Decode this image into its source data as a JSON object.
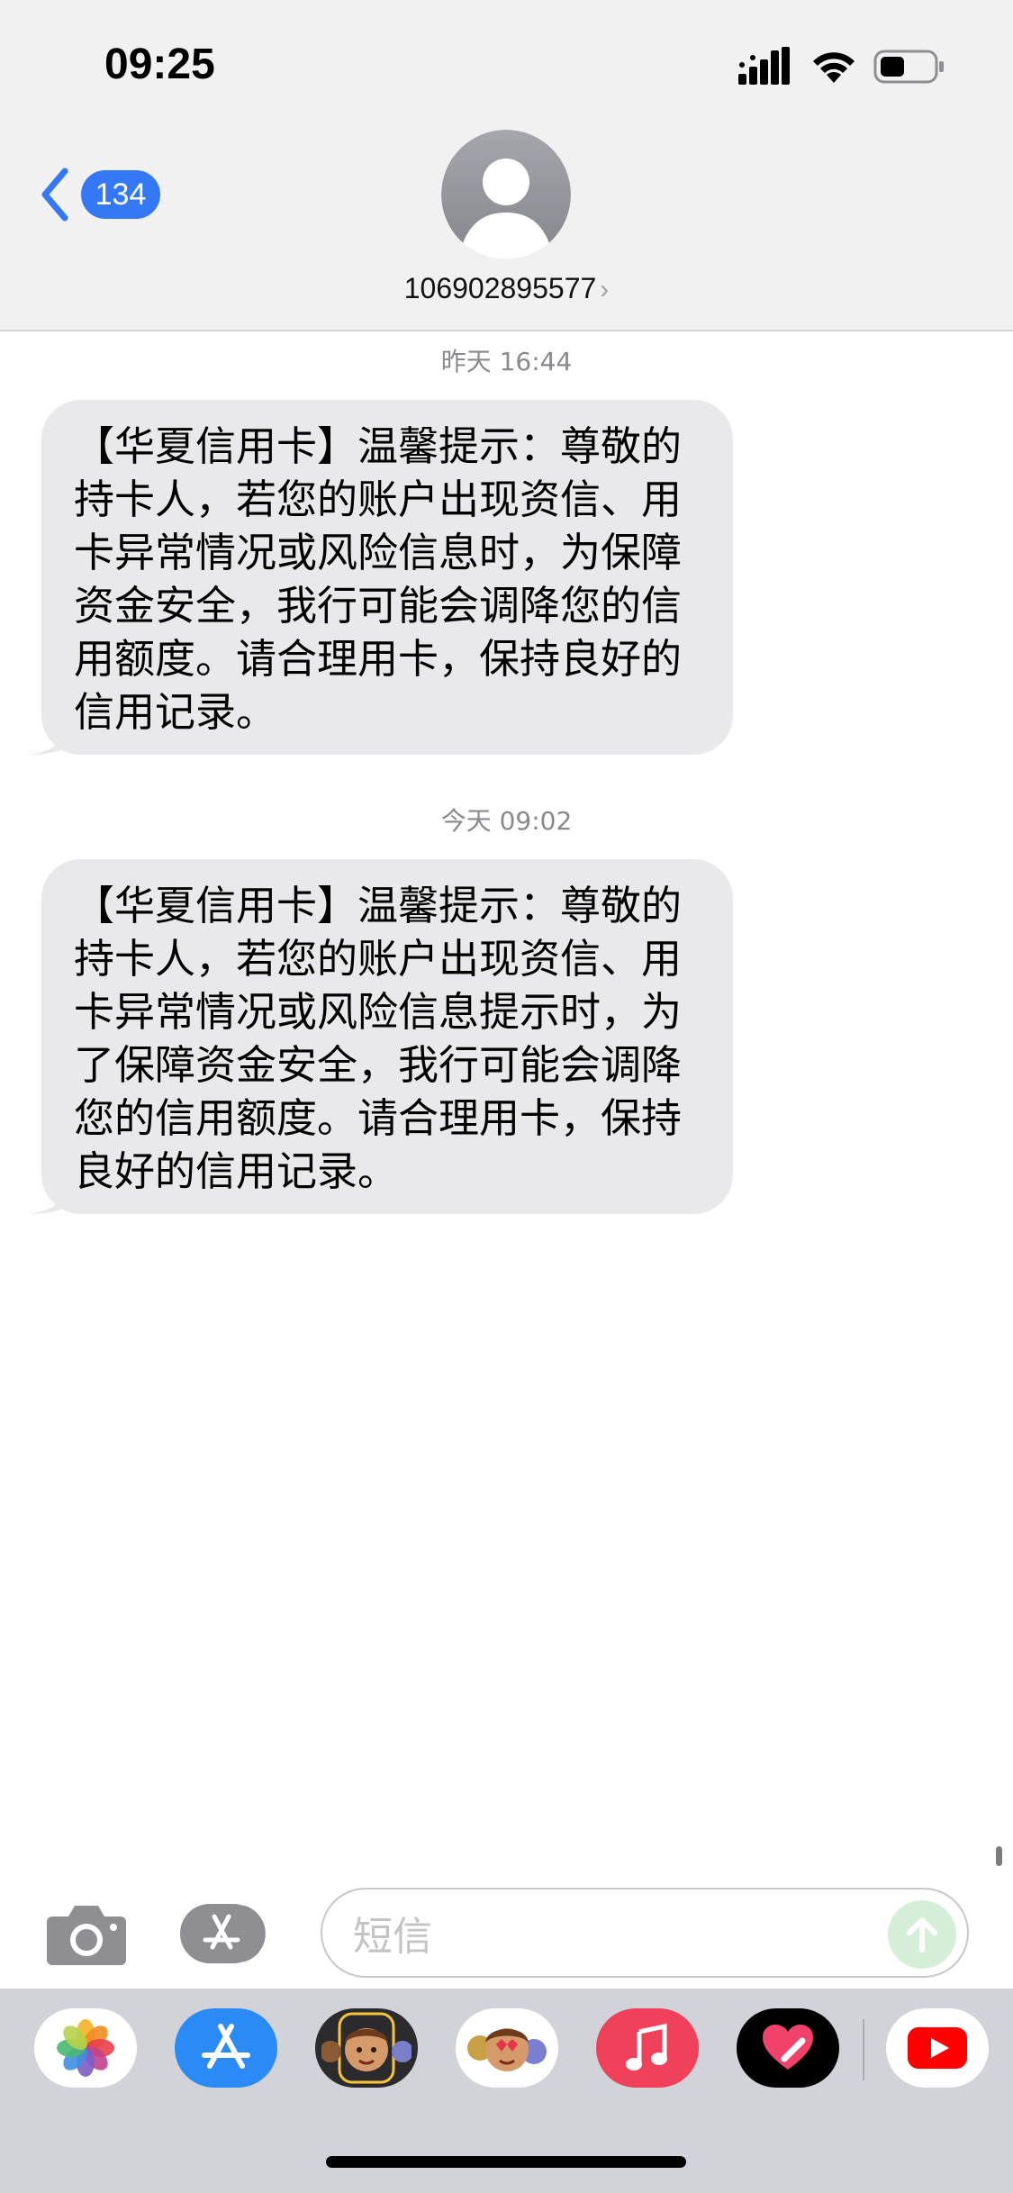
{
  "status_bar": {
    "time": "09:25"
  },
  "header": {
    "back_count": "134",
    "contact": "106902895577",
    "chevron": "›"
  },
  "messages": [
    {
      "timestamp": "昨天 16:44",
      "text": "【华夏信用卡】温馨提示：尊敬的持卡人，若您的账户出现资信、用卡异常情况或风险信息时，为保障资金安全，我行可能会调降您的信用额度。请合理用卡，保持良好的信用记录。"
    },
    {
      "timestamp": "今天 09:02",
      "text": "【华夏信用卡】温馨提示：尊敬的持卡人，若您的账户出现资信、用卡异常情况或风险信息提示时，为了保障资金安全，我行可能会调降您的信用额度。请合理用卡，保持良好的信用记录。"
    }
  ],
  "input_bar": {
    "placeholder": "短信"
  },
  "app_drawer": {
    "apps": [
      "photos-icon",
      "app-store-icon",
      "memoji-icon",
      "animoji-icon",
      "music-icon",
      "digital-touch-icon",
      "youtube-icon"
    ]
  },
  "colors": {
    "accent": "#3478f6",
    "bubble": "#e9e9eb",
    "send_disabled": "#d6efd9"
  }
}
